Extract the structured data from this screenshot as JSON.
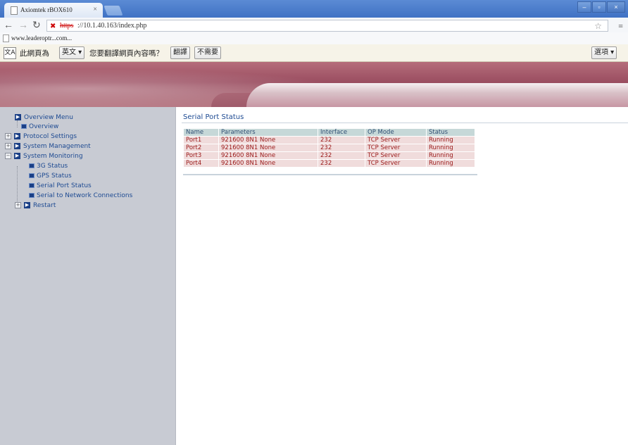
{
  "browser": {
    "tab_title": "Axiomtek rBOX610",
    "tab_close": "×",
    "url_scheme": "https",
    "url_rest": "://10.1.40.163/index.php",
    "bookmark": "www.leaderoptr...com..."
  },
  "translate_bar": {
    "prefix": "此網頁為",
    "language": "英文",
    "question": "您要翻譯網頁內容嗎？",
    "translate_button": "翻譯",
    "no_button": "不需要",
    "options_button": "選項"
  },
  "sidebar": {
    "overview_menu": "Overview Menu",
    "overview": "Overview",
    "protocol_settings": "Protocol Settings",
    "system_management": "System Management",
    "system_monitoring": "System Monitoring",
    "monitoring_items": [
      "3G Status",
      "GPS Status",
      "Serial Port Status",
      "Serial to Network Connections"
    ],
    "restart": "Restart"
  },
  "main": {
    "title": "Serial Port Status",
    "columns": [
      "Name",
      "Parameters",
      "Interface",
      "OP Mode",
      "Status"
    ],
    "rows": [
      [
        "Port1",
        "921600 8N1 None",
        "232",
        "TCP Server",
        "Running"
      ],
      [
        "Port2",
        "921600 8N1 None",
        "232",
        "TCP Server",
        "Running"
      ],
      [
        "Port3",
        "921600 8N1 None",
        "232",
        "TCP Server",
        "Running"
      ],
      [
        "Port4",
        "921600 8N1 None",
        "232",
        "TCP Server",
        "Running"
      ]
    ]
  },
  "colors": {
    "tabstrip": "#4a7dcb",
    "menu_text": "#1d4a92",
    "header_bg": "#c6d8d8",
    "row_bg": "#f0dcdc",
    "row_text": "#9b1a1a",
    "sidebar_bg": "#c8cbd3"
  },
  "icons": [
    "page-icon",
    "back-arrow-icon",
    "forward-arrow-icon",
    "reload-icon",
    "broken-lock-icon",
    "star-icon",
    "menu-icon",
    "translate-icon",
    "arrow-box-icon",
    "bullet-icon",
    "plus-icon"
  ]
}
